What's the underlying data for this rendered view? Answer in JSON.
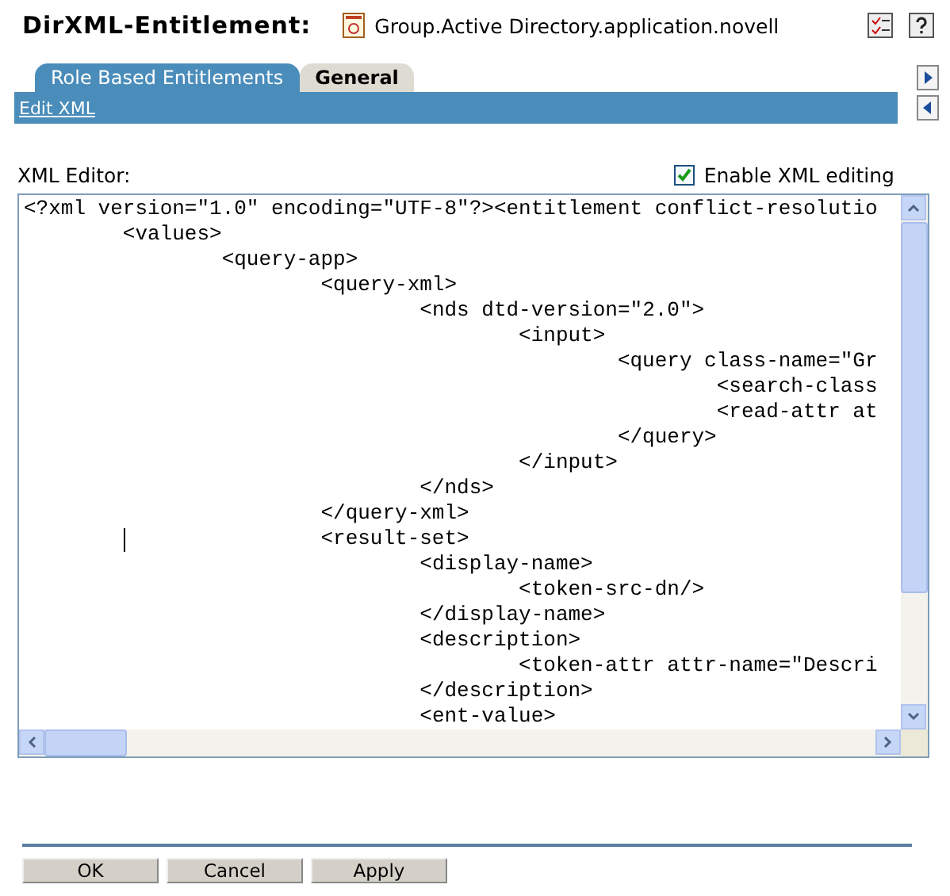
{
  "header": {
    "title": "DirXML-Entitlement:",
    "object_name": "Group.Active Directory.application.novell"
  },
  "tabs": [
    {
      "label": "Role Based Entitlements",
      "selected": true
    },
    {
      "label": "General",
      "selected": false
    }
  ],
  "subnav": {
    "link": "Edit XML"
  },
  "editor": {
    "label": "XML Editor:",
    "enable_checkbox": {
      "label": "Enable XML editing",
      "checked": true
    },
    "lines": [
      "<?xml version=\"1.0\" encoding=\"UTF-8\"?><entitlement conflict-resolutio",
      "\t<values>",
      "\t\t<query-app>",
      "\t\t\t<query-xml>",
      "\t\t\t\t<nds dtd-version=\"2.0\">",
      "\t\t\t\t\t<input>",
      "\t\t\t\t\t\t<query class-name=\"Gr",
      "\t\t\t\t\t\t\t<search-class",
      "\t\t\t\t\t\t\t<read-attr at",
      "\t\t\t\t\t\t</query>",
      "\t\t\t\t\t</input>",
      "\t\t\t\t</nds>",
      "\t\t\t</query-xml>",
      "\t\t\t<result-set>",
      "\t\t\t\t<display-name>",
      "\t\t\t\t\t<token-src-dn/>",
      "\t\t\t\t</display-name>",
      "\t\t\t\t<description>",
      "\t\t\t\t\t<token-attr attr-name=\"Descri",
      "\t\t\t\t</description>",
      "\t\t\t\t<ent-value>"
    ]
  },
  "buttons": [
    "OK",
    "Cancel",
    "Apply"
  ]
}
